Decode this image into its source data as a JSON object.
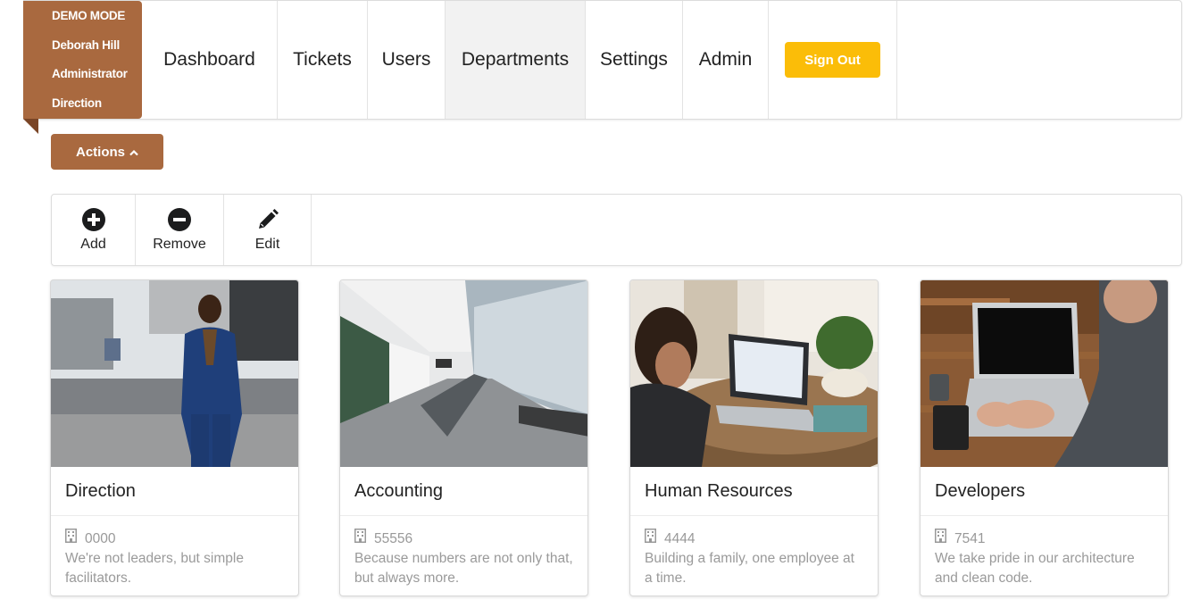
{
  "user": {
    "mode": "DEMO MODE",
    "name": "Deborah Hill",
    "role": "Administrator",
    "department": "Direction"
  },
  "nav": {
    "items": [
      {
        "label": "Dashboard"
      },
      {
        "label": "Tickets"
      },
      {
        "label": "Users"
      },
      {
        "label": "Departments",
        "active": true
      },
      {
        "label": "Settings"
      },
      {
        "label": "Admin"
      }
    ],
    "signout_label": "Sign Out"
  },
  "actions": {
    "label": "Actions"
  },
  "toolbar": {
    "add_label": "Add",
    "remove_label": "Remove",
    "edit_label": "Edit"
  },
  "departments": [
    {
      "name": "Direction",
      "code": "0000",
      "description": "We're not leaders, but simple facilitators.",
      "image": "man-in-blue-suit-photo"
    },
    {
      "name": "Accounting",
      "code": "55556",
      "description": "Because numbers are not only that, but always more.",
      "image": "conference-room-photo"
    },
    {
      "name": "Human Resources",
      "code": "4444",
      "description": "Building a family, one employee at a time.",
      "image": "woman-at-laptop-photo"
    },
    {
      "name": "Developers",
      "code": "7541",
      "description": "We take pride in our architecture and clean code.",
      "image": "hands-typing-laptop-photo"
    }
  ],
  "colors": {
    "brand": "#a9693f",
    "signout": "#fbbd08",
    "active_nav": "#f2f2f2"
  }
}
